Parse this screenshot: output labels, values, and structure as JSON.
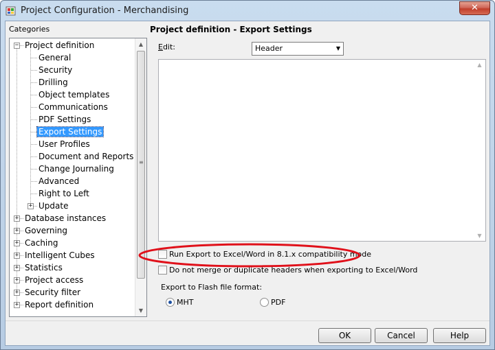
{
  "window": {
    "title": "Project Configuration - Merchandising",
    "close_glyph": "✕"
  },
  "sidebar": {
    "header": "Categories",
    "tree": [
      {
        "label": "Project definition",
        "level": 0,
        "expander": "−",
        "selected": false
      },
      {
        "label": "General",
        "level": 1,
        "expander": "",
        "selected": false
      },
      {
        "label": "Security",
        "level": 1,
        "expander": "",
        "selected": false
      },
      {
        "label": "Drilling",
        "level": 1,
        "expander": "",
        "selected": false
      },
      {
        "label": "Object templates",
        "level": 1,
        "expander": "",
        "selected": false
      },
      {
        "label": "Communications",
        "level": 1,
        "expander": "",
        "selected": false
      },
      {
        "label": "PDF Settings",
        "level": 1,
        "expander": "",
        "selected": false
      },
      {
        "label": "Export Settings",
        "level": 1,
        "expander": "",
        "selected": true
      },
      {
        "label": "User Profiles",
        "level": 1,
        "expander": "",
        "selected": false
      },
      {
        "label": "Document and Reports",
        "level": 1,
        "expander": "",
        "selected": false
      },
      {
        "label": "Change Journaling",
        "level": 1,
        "expander": "",
        "selected": false
      },
      {
        "label": "Advanced",
        "level": 1,
        "expander": "",
        "selected": false
      },
      {
        "label": "Right to Left",
        "level": 1,
        "expander": "",
        "selected": false
      },
      {
        "label": "Update",
        "level": 1,
        "expander": "+",
        "selected": false
      },
      {
        "label": "Database instances",
        "level": 0,
        "expander": "+",
        "selected": false
      },
      {
        "label": "Governing",
        "level": 0,
        "expander": "+",
        "selected": false
      },
      {
        "label": "Caching",
        "level": 0,
        "expander": "+",
        "selected": false
      },
      {
        "label": "Intelligent Cubes",
        "level": 0,
        "expander": "+",
        "selected": false
      },
      {
        "label": "Statistics",
        "level": 0,
        "expander": "+",
        "selected": false
      },
      {
        "label": "Project access",
        "level": 0,
        "expander": "+",
        "selected": false
      },
      {
        "label": "Security filter",
        "level": 0,
        "expander": "+",
        "selected": false
      },
      {
        "label": "Report definition",
        "level": 0,
        "expander": "+",
        "selected": false
      }
    ],
    "scroll_up_glyph": "▲",
    "scroll_down_glyph": "▼",
    "scroll_grip_glyph": "≡"
  },
  "main": {
    "section_title": "Project definition - Export Settings",
    "edit_label_mnemonic": "E",
    "edit_label_rest": "dit:",
    "edit_select_value": "Header",
    "select_arrow_glyph": "▼",
    "editor_scroll_up_glyph": "▲",
    "editor_scroll_down_glyph": "▼",
    "checkbox_compat_label": "Run Export to Excel/Word in 8.1.x compatibility mode",
    "checkbox_compat_checked": false,
    "checkbox_merge_label": "Do not merge or duplicate headers when exporting to Excel/Word",
    "checkbox_merge_checked": false,
    "flash_format_label": "Export to Flash file format:",
    "radio_mht_label": "MHT",
    "radio_mht_selected": true,
    "radio_pdf_label": "PDF",
    "radio_pdf_selected": false
  },
  "buttons": {
    "ok": "OK",
    "cancel": "Cancel",
    "help": "Help"
  },
  "colors": {
    "selection": "#3399ff",
    "highlight_annotation": "#e0101a"
  }
}
